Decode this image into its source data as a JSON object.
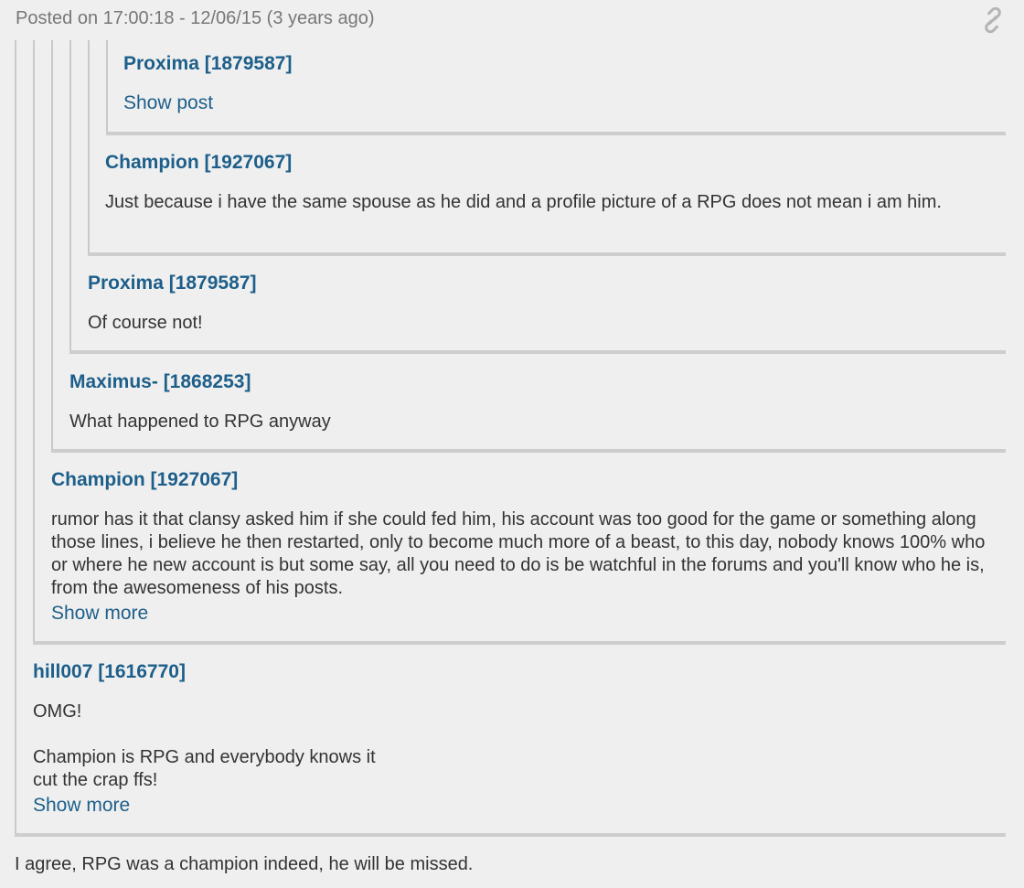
{
  "post": {
    "posted_text": "Posted on 17:00:18 - 12/06/15 (3 years ago)",
    "link_icon": "link-icon",
    "body": "I agree, RPG was a champion indeed, he will be missed."
  },
  "quotes": [
    {
      "author": "Proxima [1879587]",
      "show_post_label": "Show post"
    },
    {
      "author": "Champion [1927067]",
      "text": "Just because i have the same spouse as he did and a profile picture of a RPG does not mean i am him."
    },
    {
      "author": "Proxima [1879587]",
      "text": "Of course not!"
    },
    {
      "author": "Maximus- [1868253]",
      "text": "What happened to RPG anyway"
    },
    {
      "author": "Champion [1927067]",
      "text": "rumor has it that clansy asked him if she could fed him, his account was too good for the game or something along those lines, i believe he then restarted, only to become much more of a beast, to this day, nobody knows 100% who or where he new account is but some say, all you need to do is be watchful in the forums and you'll know who he is, from the awesomeness of his posts.",
      "show_more_label": "Show more"
    },
    {
      "author": "hill007 [1616770]",
      "text": "OMG!\n\nChampion is RPG and everybody knows it\ncut the crap ffs!",
      "show_more_label": "Show more"
    }
  ],
  "colors": {
    "background": "#efefef",
    "author": "#1d5f8a",
    "link": "#1d5f8a",
    "text": "#333333",
    "muted": "#777777",
    "quote_border": "#cdcdcd"
  }
}
